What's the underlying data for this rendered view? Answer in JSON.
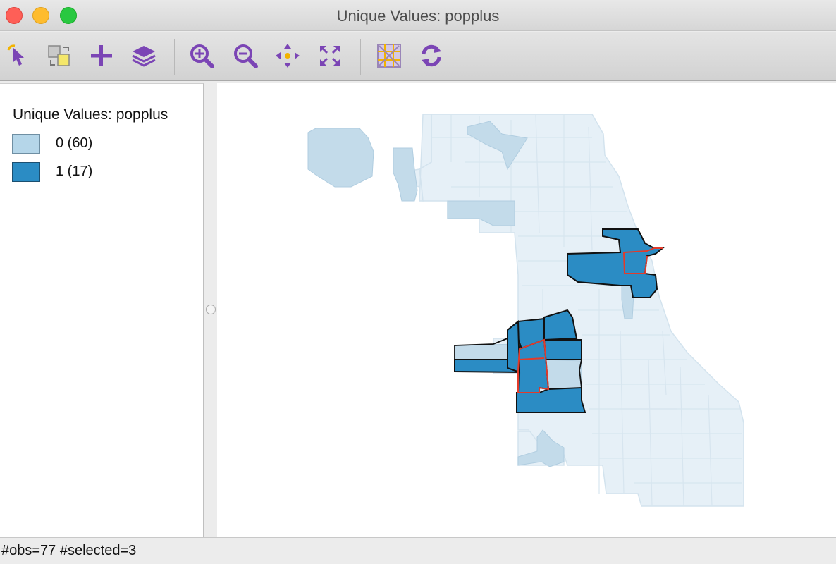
{
  "window": {
    "title": "Unique Values: popplus"
  },
  "toolbar": {
    "tools": [
      {
        "name": "select-tool",
        "icon": "pointer-arrow-icon"
      },
      {
        "name": "selection-shape-tool",
        "icon": "select-shape-icon"
      },
      {
        "name": "add-tool",
        "icon": "plus-icon"
      },
      {
        "name": "layers-tool",
        "icon": "layers-icon"
      },
      {
        "name": "zoom-in-tool",
        "icon": "zoom-in-icon"
      },
      {
        "name": "zoom-out-tool",
        "icon": "zoom-out-icon"
      },
      {
        "name": "pan-tool",
        "icon": "pan-icon"
      },
      {
        "name": "fit-extent-tool",
        "icon": "fit-extent-icon"
      },
      {
        "name": "basemap-tool",
        "icon": "basemap-icon"
      },
      {
        "name": "refresh-tool",
        "icon": "refresh-icon"
      }
    ],
    "accent_color": "#7b45b5"
  },
  "legend": {
    "title": "Unique Values: popplus",
    "items": [
      {
        "label": "0 (60)",
        "color": "#b5d6e9"
      },
      {
        "label": "1 (17)",
        "color": "#2b8cc4"
      }
    ]
  },
  "map": {
    "unselected_fill": "#e6f0f7",
    "selection_outline_color": "#e23b2b"
  },
  "status": {
    "text": "#obs=77 #selected=3"
  }
}
